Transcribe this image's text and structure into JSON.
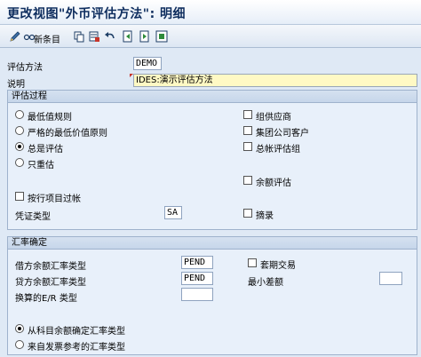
{
  "window": {
    "title": "更改视图\"外币评估方法\": 明细"
  },
  "toolbar": {
    "new_entries_label": "新条目"
  },
  "header": {
    "method_label": "评估方法",
    "method_value": "DEMO",
    "desc_label": "说明",
    "desc_value": "IDES:演示评估方法"
  },
  "procedure": {
    "title": "评估过程",
    "radio_lowest": "最低值规则",
    "radio_strict_lowest": "严格的最低价值原则",
    "radio_always": "总是评估",
    "radio_revalue_only": "只重估",
    "chk_group_ar": "组供应商",
    "chk_group_customer": "集团公司客户",
    "chk_gl_group": "总帐评估组",
    "chk_balance": "余额评估",
    "chk_by_item": "按行项目过帐",
    "doc_type_label": "凭证类型",
    "doc_type_value": "SA",
    "chk_extract": "摘录"
  },
  "exchange": {
    "title": "汇率确定",
    "debit_label": "借方余额汇率类型",
    "debit_value": "PEND",
    "credit_label": "贷方余额汇率类型",
    "credit_value": "PEND",
    "er_label": "换算的E/R 类型",
    "er_value": "",
    "chk_hedge": "套期交易",
    "min_diff_label": "最小差额",
    "min_diff_value": "",
    "radio_from_balance": "从科目余额确定汇率类型",
    "radio_from_invoice": "来自发票参考的汇率类型"
  }
}
